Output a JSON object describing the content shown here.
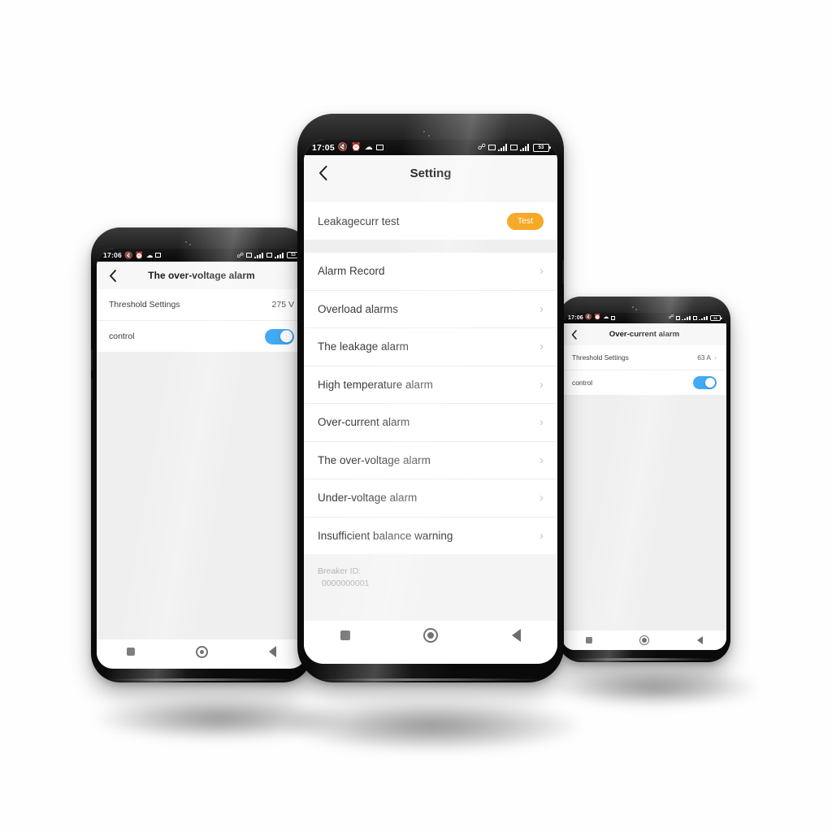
{
  "scene": {
    "background_color": "#fefefe",
    "accent_orange": "#f7a825",
    "toggle_on_color": "#3fa9f5"
  },
  "center_phone": {
    "status_bar": {
      "time": "17:05",
      "left_icons": [
        "mute-icon",
        "alarm-icon",
        "weather-icon",
        "screenshot-icon"
      ],
      "right_icons": [
        "bluetooth-icon",
        "wifi-icon",
        "signal-icon",
        "sim-icon",
        "lte-icon",
        "signal2-icon"
      ],
      "battery_text": "53"
    },
    "header": {
      "title": "Setting",
      "back_icon": "back-chevron-icon"
    },
    "test_row": {
      "label": "Leakagecurr test",
      "button_label": "Test"
    },
    "menu_items": [
      {
        "label": "Alarm Record"
      },
      {
        "label": "Overload alarms"
      },
      {
        "label": "The leakage alarm"
      },
      {
        "label": "High temperature alarm"
      },
      {
        "label": "Over-current alarm"
      },
      {
        "label": "The over-voltage alarm"
      },
      {
        "label": "Under-voltage alarm"
      },
      {
        "label": "Insufficient balance warning"
      }
    ],
    "footer": {
      "breaker_id_label": "Breaker ID:",
      "breaker_id_value": "0000000001"
    },
    "nav_bar": {
      "recents": "recents-square-icon",
      "home": "home-circle-icon",
      "back": "back-triangle-icon"
    }
  },
  "left_phone": {
    "status_bar": {
      "time": "17:06",
      "battery_text": "53"
    },
    "header": {
      "title": "The over-voltage alarm",
      "back_icon": "back-chevron-icon"
    },
    "rows": [
      {
        "label": "Threshold Settings",
        "value": "275 V",
        "type": "value"
      },
      {
        "label": "control",
        "value": "on",
        "type": "toggle"
      }
    ]
  },
  "right_phone": {
    "status_bar": {
      "time": "17:06",
      "battery_text": "53"
    },
    "header": {
      "title": "Over-current alarm",
      "back_icon": "back-chevron-icon"
    },
    "rows": [
      {
        "label": "Threshold Settings",
        "value": "63 A",
        "type": "value"
      },
      {
        "label": "control",
        "value": "on",
        "type": "toggle"
      }
    ]
  }
}
